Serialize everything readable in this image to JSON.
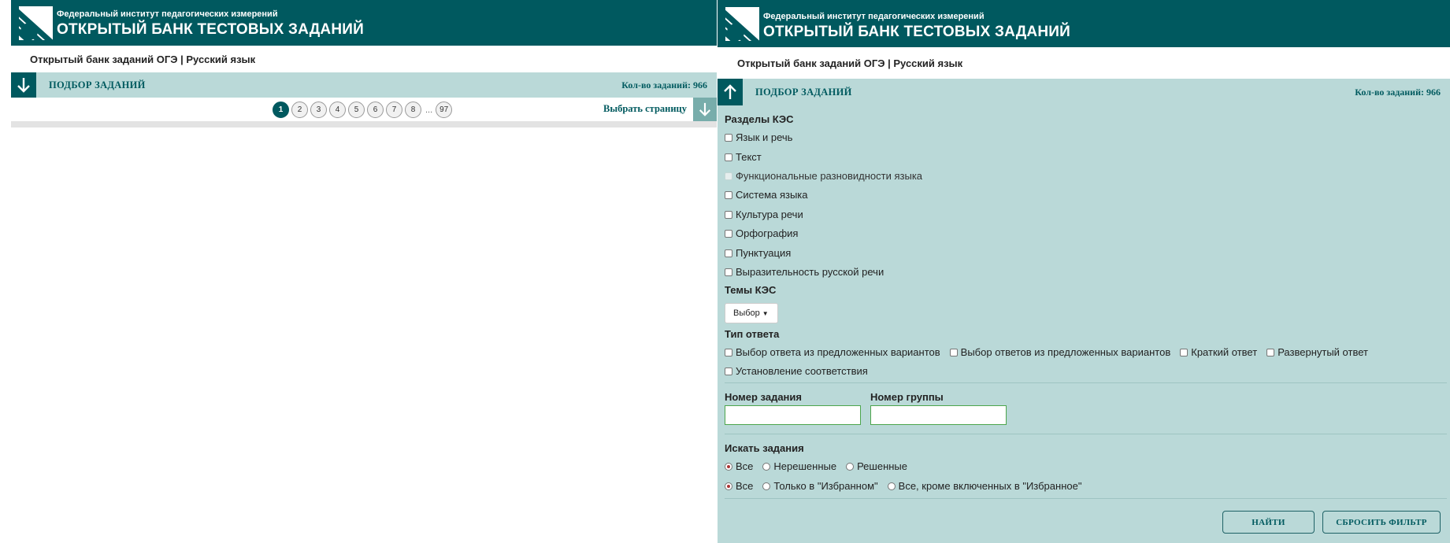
{
  "header": {
    "subtitle": "Федеральный институт педагогических измерений",
    "title": "ОТКРЫТЫЙ БАНК ТЕСТОВЫХ ЗАДАНИЙ"
  },
  "breadcrumb": "Открытый банк заданий ОГЭ | Русский язык",
  "filterbar": {
    "title": "ПОДБОР ЗАДАНИЙ",
    "count": "Кол-во заданий: 966"
  },
  "pager": {
    "pages": [
      "1",
      "2",
      "3",
      "4",
      "5",
      "6",
      "7",
      "8"
    ],
    "ellipsis": "...",
    "last": "97",
    "select_page": "Выбрать страницу"
  },
  "form": {
    "sections_title": "Разделы КЭС",
    "sections": [
      "Язык и речь",
      "Текст",
      "Функциональные разновидности языка",
      "Система языка",
      "Культура речи",
      "Орфография",
      "Пунктуация",
      "Выразительность русской речи"
    ],
    "topics_title": "Темы КЭС",
    "topics_dropdown": "Выбор",
    "answer_type_title": "Тип ответа",
    "answer_types": [
      "Выбор ответа из предложенных вариантов",
      "Выбор ответов из предложенных вариантов",
      "Краткий ответ",
      "Развернутый ответ",
      "Установление соответствия"
    ],
    "task_number_label": "Номер задания",
    "group_number_label": "Номер группы",
    "search_title": "Искать задания",
    "search_status": [
      "Все",
      "Нерешенные",
      "Решенные"
    ],
    "search_favorites": [
      "Все",
      "Только в \"Избранном\"",
      "Все, кроме включенных в \"Избранное\""
    ],
    "find_button": "НАЙТИ",
    "reset_button": "СБРОСИТЬ ФИЛЬТР"
  }
}
